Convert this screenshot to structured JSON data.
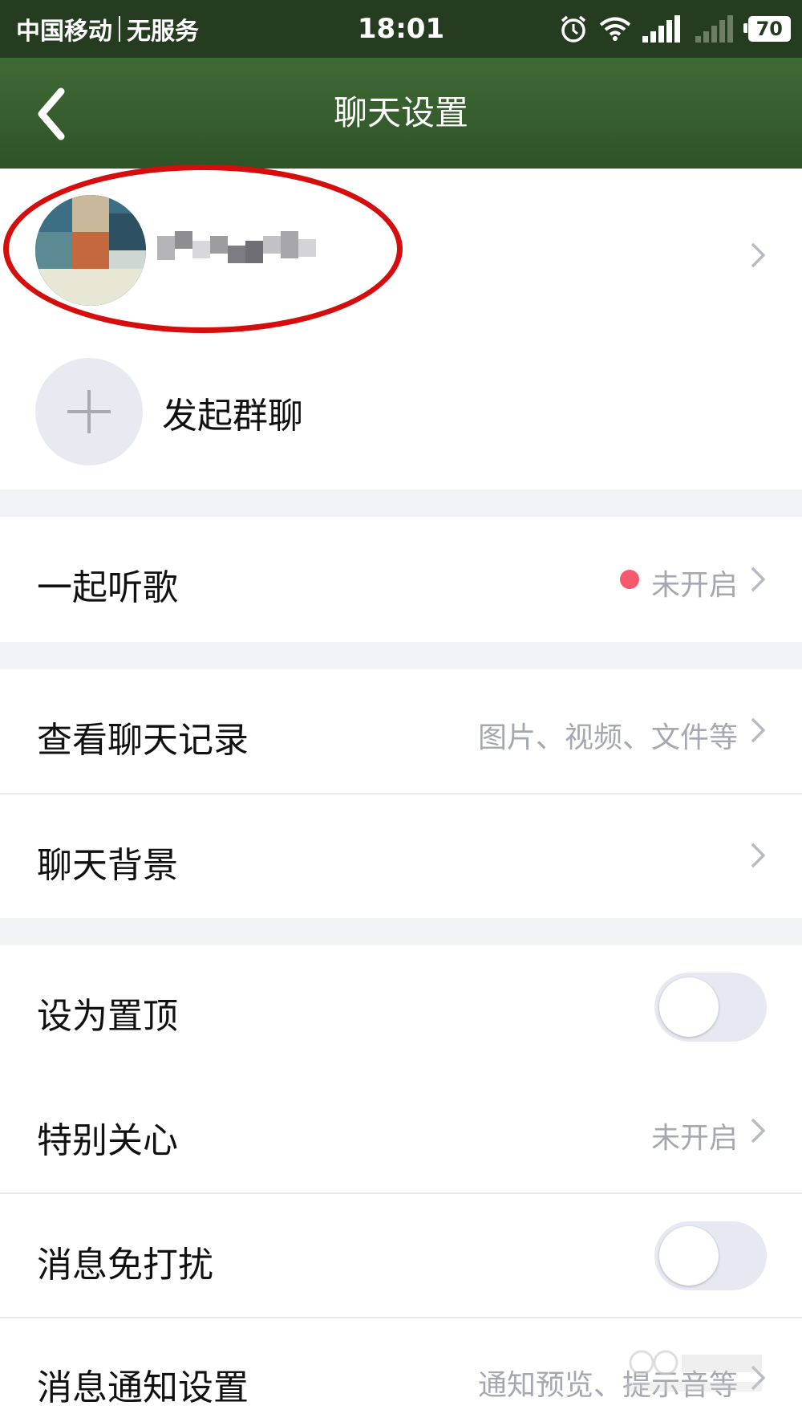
{
  "status_bar": {
    "carrier": "中国移动",
    "service": "无服务",
    "time": "18:01",
    "battery": "70"
  },
  "nav": {
    "title": "聊天设置"
  },
  "group_chat": {
    "label": "发起群聊"
  },
  "listen_together": {
    "label": "一起听歌",
    "status": "未开启"
  },
  "chat_history": {
    "label": "查看聊天记录",
    "detail": "图片、视频、文件等"
  },
  "chat_background": {
    "label": "聊天背景"
  },
  "pin_top": {
    "label": "设为置顶",
    "enabled": false
  },
  "special_care": {
    "label": "特别关心",
    "status": "未开启"
  },
  "do_not_disturb": {
    "label": "消息免打扰",
    "enabled": false
  },
  "notification_settings": {
    "label": "消息通知设置",
    "detail": "通知预览、提示音等"
  },
  "colors": {
    "header": "#2f5327",
    "status_bar": "#253c20",
    "accent_dot": "#f7586b",
    "annotation": "#d50d0d"
  }
}
